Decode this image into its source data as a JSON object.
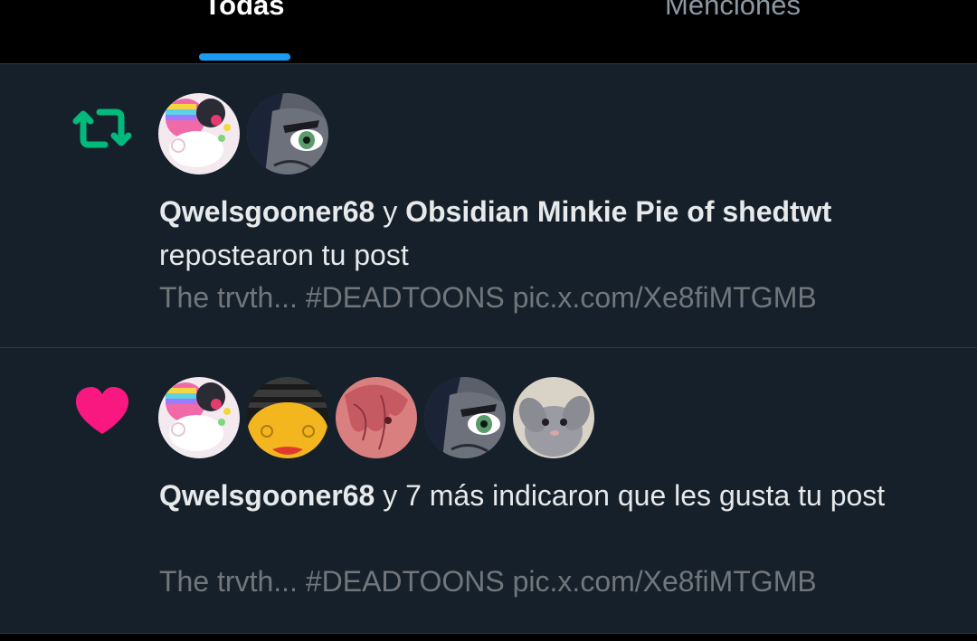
{
  "tabs": [
    {
      "label": "Todas",
      "active": true
    },
    {
      "label": "Menciones",
      "active": false
    }
  ],
  "notifications": [
    {
      "type": "repost",
      "icon": "repost-icon",
      "icon_color": "#00ba7c",
      "actor1": "Qwelsgooner68",
      "connector": "y",
      "actor2": "Obsidian Minkie Pie of shedtwt",
      "action": "repostearon tu post",
      "preview": "The trvth... #DEADTOONS pic.x.com/Xe8fiMTGMB",
      "avatar_count": 2
    },
    {
      "type": "like",
      "icon": "heart-icon",
      "icon_color": "#f91880",
      "actor1": "Qwelsgooner68",
      "action": "y 7 más indicaron que les gusta tu post",
      "preview": "The trvth... #DEADTOONS pic.x.com/Xe8fiMTGMB",
      "avatar_count": 5
    }
  ]
}
